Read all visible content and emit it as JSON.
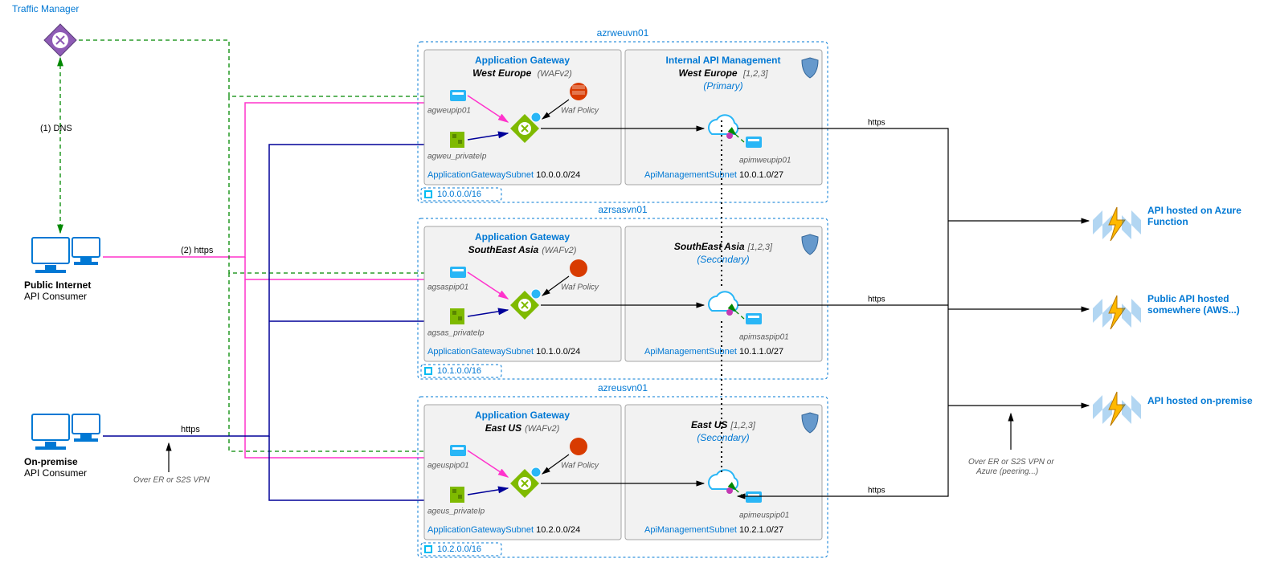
{
  "trafficManager": {
    "title": "Traffic Manager"
  },
  "consumers": {
    "public": {
      "title": "Public Internet",
      "sub": "API Consumer"
    },
    "onprem": {
      "title": "On-premise",
      "sub": "API Consumer"
    }
  },
  "labels": {
    "dns": "(1) DNS",
    "httpsPub": "(2) https",
    "httpsOnprem": "https",
    "erNote": "Over ER or S2S VPN",
    "httpsRight": "https",
    "erNoteRight": "Over ER or S2S VPN or\nAzure (peering...)"
  },
  "vnets": [
    {
      "name": "azrweuvn01",
      "cidr": "10.0.0.0/16",
      "appgw": {
        "title": "Application Gateway",
        "region": "West Europe",
        "sku": "(WAFv2)",
        "pip": "agweupip01",
        "privateip": "agweu_privateIp",
        "subnetLabel": "ApplicationGatewaySubnet",
        "cidr": "10.0.0.0/24",
        "wafLabel": "Waf Policy"
      },
      "apim": {
        "title": "Internal API Management",
        "region": "West Europe",
        "zones": "[1,2,3]",
        "role": "(Primary)",
        "pip": "apimweupip01",
        "subnetLabel": "ApiManagementSubnet",
        "cidr": "10.0.1.0/27"
      }
    },
    {
      "name": "azrsasvn01",
      "cidr": "10.1.0.0/16",
      "appgw": {
        "title": "Application Gateway",
        "region": "SouthEast Asia",
        "sku": "(WAFv2)",
        "pip": "agsaspip01",
        "privateip": "agsas_privateIp",
        "subnetLabel": "ApplicationGatewaySubnet",
        "cidr": "10.1.0.0/24",
        "wafLabel": "Waf Policy"
      },
      "apim": {
        "title": "",
        "region": "SouthEast Asia",
        "zones": "[1,2,3]",
        "role": "(Secondary)",
        "pip": "apimsaspip01",
        "subnetLabel": "ApiManagementSubnet",
        "cidr": "10.1.1.0/27"
      }
    },
    {
      "name": "azreusvn01",
      "cidr": "10.2.0.0/16",
      "appgw": {
        "title": "Application Gateway",
        "region": "East US",
        "sku": "(WAFv2)",
        "pip": "ageuspip01",
        "privateip": "ageus_privateIp",
        "subnetLabel": "ApplicationGatewaySubnet",
        "cidr": "10.2.0.0/24",
        "wafLabel": "Waf Policy"
      },
      "apim": {
        "title": "",
        "region": "East US",
        "zones": "[1,2,3]",
        "role": "(Secondary)",
        "pip": "apimeuspip01",
        "subnetLabel": "ApiManagementSubnet",
        "cidr": "10.2.1.0/27"
      }
    }
  ],
  "apis": [
    {
      "label": "API hosted on Azure Function"
    },
    {
      "label": "Public API hosted somewhere (AWS...)"
    },
    {
      "label": "API hosted on-premise"
    }
  ]
}
